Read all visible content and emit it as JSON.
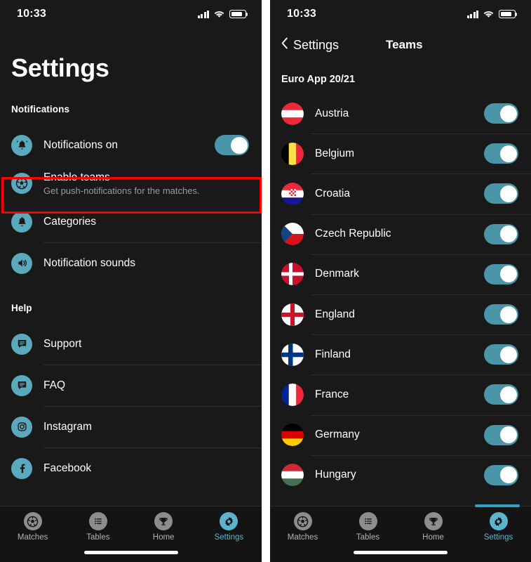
{
  "status_bar": {
    "time": "10:33",
    "signal_icon": "cellular-bars-icon",
    "wifi_icon": "wifi-icon",
    "battery_icon": "battery-icon"
  },
  "colors": {
    "accent_teal": "#5aa9bd",
    "toggle_on": "#4a95a8",
    "tab_active": "#5ab4cd",
    "highlight_red": "#ff0000",
    "background": "#191919"
  },
  "left_panel": {
    "page_title": "Settings",
    "sections": [
      {
        "heading": "Notifications",
        "rows": [
          {
            "icon": "bell-ringing-icon",
            "title": "Notifications on",
            "subtitle": "",
            "toggle": true,
            "toggle_on": true,
            "highlighted": false
          },
          {
            "icon": "soccer-ball-icon",
            "title": "Enable teams",
            "subtitle": "Get push-notifications for the matches.",
            "toggle": false,
            "toggle_on": false,
            "highlighted": true
          },
          {
            "icon": "bell-icon",
            "title": "Categories",
            "subtitle": "",
            "toggle": false,
            "toggle_on": false,
            "highlighted": false
          },
          {
            "icon": "speaker-sound-icon",
            "title": "Notification sounds",
            "subtitle": "",
            "toggle": false,
            "toggle_on": false,
            "highlighted": false
          }
        ]
      },
      {
        "heading": "Help",
        "rows": [
          {
            "icon": "chat-bubble-icon",
            "title": "Support",
            "subtitle": "",
            "toggle": false,
            "toggle_on": false,
            "highlighted": false
          },
          {
            "icon": "chat-bubble-icon",
            "title": "FAQ",
            "subtitle": "",
            "toggle": false,
            "toggle_on": false,
            "highlighted": false
          },
          {
            "icon": "instagram-icon",
            "title": "Instagram",
            "subtitle": "",
            "toggle": false,
            "toggle_on": false,
            "highlighted": false
          },
          {
            "icon": "facebook-icon",
            "title": "Facebook",
            "subtitle": "",
            "toggle": false,
            "toggle_on": false,
            "highlighted": false
          }
        ]
      }
    ]
  },
  "right_panel": {
    "back_label": "Settings",
    "back_icon": "chevron-left-icon",
    "nav_title": "Teams",
    "list_heading": "Euro App 20/21",
    "teams": [
      {
        "name": "Austria",
        "flag": "flag-austria",
        "toggle_on": true
      },
      {
        "name": "Belgium",
        "flag": "flag-belgium",
        "toggle_on": true
      },
      {
        "name": "Croatia",
        "flag": "flag-croatia",
        "toggle_on": true
      },
      {
        "name": "Czech Republic",
        "flag": "flag-czechia",
        "toggle_on": true
      },
      {
        "name": "Denmark",
        "flag": "flag-denmark",
        "toggle_on": true
      },
      {
        "name": "England",
        "flag": "flag-england",
        "toggle_on": true
      },
      {
        "name": "Finland",
        "flag": "flag-finland",
        "toggle_on": true
      },
      {
        "name": "France",
        "flag": "flag-france",
        "toggle_on": true
      },
      {
        "name": "Germany",
        "flag": "flag-germany",
        "toggle_on": true
      },
      {
        "name": "Hungary",
        "flag": "flag-hungary",
        "toggle_on": true
      }
    ]
  },
  "tab_bar": {
    "tabs": [
      {
        "label": "Matches",
        "icon": "soccer-ball-icon",
        "active": false
      },
      {
        "label": "Tables",
        "icon": "list-icon",
        "active": false
      },
      {
        "label": "Home",
        "icon": "trophy-icon",
        "active": false
      },
      {
        "label": "Settings",
        "icon": "gear-icon",
        "active": true
      }
    ]
  }
}
